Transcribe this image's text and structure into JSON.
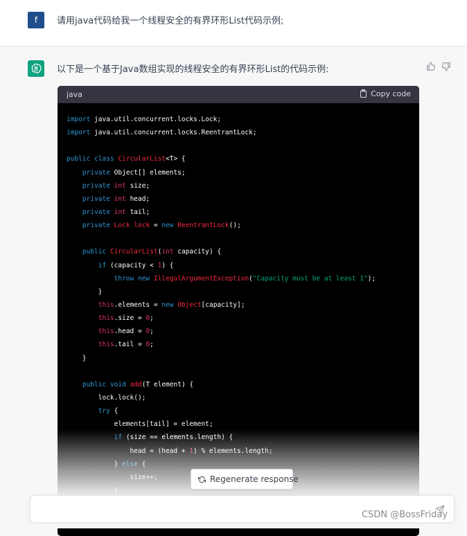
{
  "user": {
    "avatar_letter": "f",
    "message": "请用java代码给我一个线程安全的有界环形List代码示例;"
  },
  "assistant": {
    "intro": "以下是一个基于Java数组实现的线程安全的有界环形List的代码示例:"
  },
  "code_block": {
    "language": "java",
    "copy_label": "Copy code",
    "lines": [
      [
        {
          "t": "import",
          "c": "kw"
        },
        {
          "t": " java.util.concurrent.locks.Lock;"
        }
      ],
      [
        {
          "t": "import",
          "c": "kw"
        },
        {
          "t": " java.util.concurrent.locks.ReentrantLock;"
        }
      ],
      [],
      [
        {
          "t": "public",
          "c": "kw"
        },
        {
          "t": " "
        },
        {
          "t": "class",
          "c": "kw"
        },
        {
          "t": " "
        },
        {
          "t": "CircularList",
          "c": "cl"
        },
        {
          "t": "<T> {"
        }
      ],
      [
        {
          "t": "    "
        },
        {
          "t": "private",
          "c": "kw"
        },
        {
          "t": " Object[] elements;"
        }
      ],
      [
        {
          "t": "    "
        },
        {
          "t": "private",
          "c": "kw"
        },
        {
          "t": " "
        },
        {
          "t": "int",
          "c": "ty"
        },
        {
          "t": " size;"
        }
      ],
      [
        {
          "t": "    "
        },
        {
          "t": "private",
          "c": "kw"
        },
        {
          "t": " "
        },
        {
          "t": "int",
          "c": "ty"
        },
        {
          "t": " head;"
        }
      ],
      [
        {
          "t": "    "
        },
        {
          "t": "private",
          "c": "kw"
        },
        {
          "t": " "
        },
        {
          "t": "int",
          "c": "ty"
        },
        {
          "t": " tail;"
        }
      ],
      [
        {
          "t": "    "
        },
        {
          "t": "private",
          "c": "kw"
        },
        {
          "t": " "
        },
        {
          "t": "Lock",
          "c": "cl"
        },
        {
          "t": " "
        },
        {
          "t": "lock",
          "c": "cl"
        },
        {
          "t": " = "
        },
        {
          "t": "new",
          "c": "kw"
        },
        {
          "t": " "
        },
        {
          "t": "ReentrantLock",
          "c": "cl"
        },
        {
          "t": "();"
        }
      ],
      [],
      [
        {
          "t": "    "
        },
        {
          "t": "public",
          "c": "kw"
        },
        {
          "t": " "
        },
        {
          "t": "CircularList",
          "c": "cl"
        },
        {
          "t": "("
        },
        {
          "t": "int",
          "c": "ty"
        },
        {
          "t": " capacity) {"
        }
      ],
      [
        {
          "t": "        "
        },
        {
          "t": "if",
          "c": "kw"
        },
        {
          "t": " (capacity < "
        },
        {
          "t": "1",
          "c": "nm"
        },
        {
          "t": ") {"
        }
      ],
      [
        {
          "t": "            "
        },
        {
          "t": "throw",
          "c": "kw"
        },
        {
          "t": " "
        },
        {
          "t": "new",
          "c": "kw"
        },
        {
          "t": " "
        },
        {
          "t": "IllegalArgumentException",
          "c": "cl"
        },
        {
          "t": "("
        },
        {
          "t": "\"Capacity must be at least 1\"",
          "c": "st"
        },
        {
          "t": ");"
        }
      ],
      [
        {
          "t": "        }"
        }
      ],
      [
        {
          "t": "        "
        },
        {
          "t": "this",
          "c": "ty"
        },
        {
          "t": ".elements = "
        },
        {
          "t": "new",
          "c": "kw"
        },
        {
          "t": " "
        },
        {
          "t": "Object",
          "c": "cl"
        },
        {
          "t": "[capacity];"
        }
      ],
      [
        {
          "t": "        "
        },
        {
          "t": "this",
          "c": "ty"
        },
        {
          "t": ".size = "
        },
        {
          "t": "0",
          "c": "nm"
        },
        {
          "t": ";"
        }
      ],
      [
        {
          "t": "        "
        },
        {
          "t": "this",
          "c": "ty"
        },
        {
          "t": ".head = "
        },
        {
          "t": "0",
          "c": "nm"
        },
        {
          "t": ";"
        }
      ],
      [
        {
          "t": "        "
        },
        {
          "t": "this",
          "c": "ty"
        },
        {
          "t": ".tail = "
        },
        {
          "t": "0",
          "c": "nm"
        },
        {
          "t": ";"
        }
      ],
      [
        {
          "t": "    }"
        }
      ],
      [],
      [
        {
          "t": "    "
        },
        {
          "t": "public",
          "c": "kw"
        },
        {
          "t": " "
        },
        {
          "t": "void",
          "c": "kw"
        },
        {
          "t": " "
        },
        {
          "t": "add",
          "c": "cl"
        },
        {
          "t": "(T element) {"
        }
      ],
      [
        {
          "t": "        lock.lock();"
        }
      ],
      [
        {
          "t": "        "
        },
        {
          "t": "try",
          "c": "kw"
        },
        {
          "t": " {"
        }
      ],
      [
        {
          "t": "            elements[tail] = element;"
        }
      ],
      [
        {
          "t": "            "
        },
        {
          "t": "if",
          "c": "kw"
        },
        {
          "t": " (size == elements.length) {"
        }
      ],
      [
        {
          "t": "                head = (head + "
        },
        {
          "t": "1",
          "c": "nm"
        },
        {
          "t": ") % elements.length;"
        }
      ],
      [
        {
          "t": "            } "
        },
        {
          "t": "else",
          "c": "kw"
        },
        {
          "t": " {"
        }
      ],
      [
        {
          "t": "                size++;"
        }
      ],
      [
        {
          "t": "            }"
        }
      ]
    ]
  },
  "regenerate_label": "Regenerate response",
  "input": {
    "placeholder": ""
  },
  "watermark": "CSDN @BossFriday",
  "colors": {
    "user_avatar": "#1f4e8c",
    "gpt_avatar": "#10a37f",
    "code_bg": "#000000",
    "code_header_bg": "#343541",
    "keyword": "#2e95d3",
    "type": "#df3079",
    "class": "#f22c3d",
    "string": "#00a67d"
  }
}
